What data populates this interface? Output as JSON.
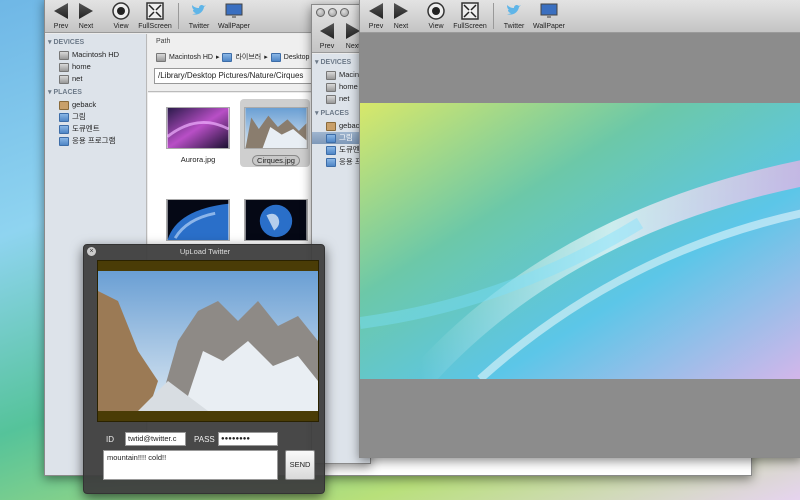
{
  "toolbar": {
    "prev": "Prev",
    "next": "Next",
    "view": "View",
    "fullscreen": "FullScreen",
    "twitter": "Twitter",
    "wallpaper": "WallPaper"
  },
  "browser": {
    "path_label": "Path",
    "crumbs": [
      "Macintosh HD",
      "라이브러",
      "Desktop"
    ],
    "path_value": "/Library/Desktop Pictures/Nature/Cirques",
    "devices_header": "DEVICES",
    "devices": [
      "Macintosh HD",
      "home",
      "net"
    ],
    "places_header": "PLACES",
    "places": [
      "geback",
      "그림",
      "도큐멘트",
      "응용 프로그램"
    ],
    "files": [
      {
        "name": "Aurora.jpg",
        "selected": false
      },
      {
        "name": "Cirques.jpg",
        "selected": true
      }
    ]
  },
  "second_window": {
    "devices_header": "DEVICES",
    "devices": [
      "Macint",
      "home",
      "net"
    ],
    "places_header": "PLACES",
    "places": [
      "geback",
      "그림",
      "도큐멘",
      "응용 프"
    ]
  },
  "twitter_dialog": {
    "title": "UpLoad Twitter",
    "id_label": "ID",
    "id_value": "twtid@twitter.c",
    "pass_label": "PASS",
    "pass_value": "●●●●●●●●",
    "message": "mountain!!!! cold!!",
    "send_label": "SEND",
    "behind_text": "uror"
  },
  "colors": {
    "sidebar_bg": "#dde3ea",
    "toolbar_bg": "#c4c4c4",
    "dialog_bg": "#3e3e3e",
    "viewer_bg": "#8c8c8c"
  }
}
